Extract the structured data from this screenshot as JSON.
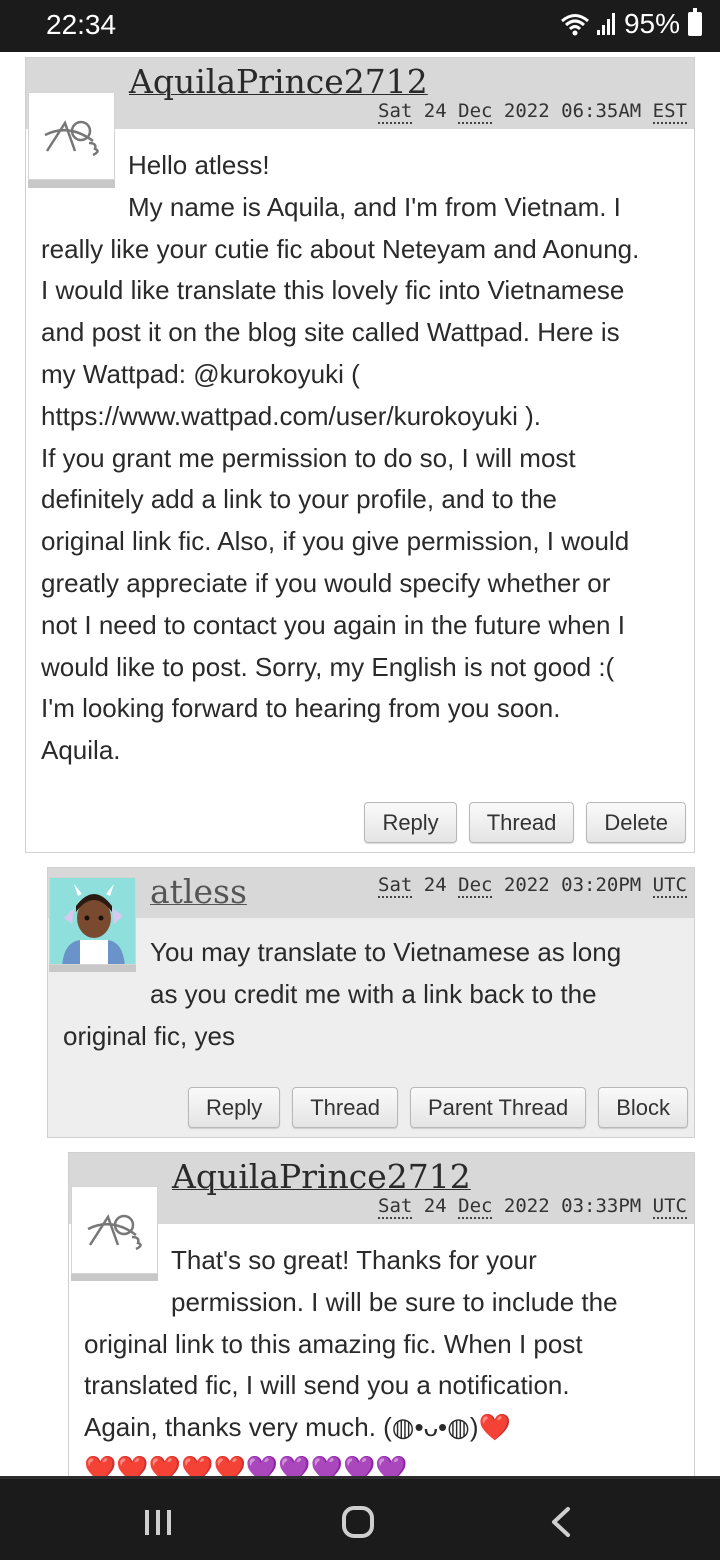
{
  "status_bar": {
    "time": "22:34",
    "battery": "95%"
  },
  "comments": [
    {
      "author": "AquilaPrince2712",
      "date": {
        "day": "Sat",
        "num": "24",
        "month": "Dec",
        "year": "2022",
        "time": "06:35AM",
        "tz": "EST"
      },
      "lines": [
        "Hello atless!",
        "My name is Aquila, and I'm from Vietnam. I",
        "really like your cutie fic about Neteyam and Aonung.",
        "I would like translate this lovely fic into Vietnamese",
        "and post it on the blog site called Wattpad. Here is",
        "my Wattpad: @kurokoyuki (",
        "https://www.wattpad.com/user/kurokoyuki ).",
        "If you grant me permission to do so, I will most",
        "definitely add a link to your profile, and to the",
        "original link fic. Also, if you give permission, I would",
        "greatly appreciate if you would specify whether or",
        "not I need to contact you again in the future when I",
        "would like to post. Sorry, my English is not good :(",
        "I'm looking forward to hearing from you soon.",
        "Aquila."
      ],
      "buttons": [
        "Reply",
        "Thread",
        "Delete"
      ]
    },
    {
      "author": "atless",
      "date": {
        "day": "Sat",
        "num": "24",
        "month": "Dec",
        "year": "2022",
        "time": "03:20PM",
        "tz": "UTC"
      },
      "lines": [
        "You may translate to Vietnamese as long",
        "as you credit me with a link back to the",
        "original fic, yes"
      ],
      "buttons": [
        "Reply",
        "Thread",
        "Parent Thread",
        "Block"
      ]
    },
    {
      "author": "AquilaPrince2712",
      "date": {
        "day": "Sat",
        "num": "24",
        "month": "Dec",
        "year": "2022",
        "time": "03:33PM",
        "tz": "UTC"
      },
      "lines": [
        "That's so great! Thanks for your",
        "permission. I will be sure to include the",
        "original link to this amazing fic. When I post",
        "translated fic, I will send you a notification.",
        "Again, thanks very much. (◍•ᴗ•◍)❤️",
        "❤️❤️❤️❤️❤️💜💜💜💜💜"
      ]
    }
  ],
  "colors": {
    "header_bg": "#d8d8d8",
    "reply_bg": "#eeeeee",
    "system_bar": "#1b1b1b"
  },
  "icons": {
    "default_avatar": "ao3-logo-icon",
    "nav": [
      "recent-apps-icon",
      "home-icon",
      "back-icon"
    ]
  }
}
